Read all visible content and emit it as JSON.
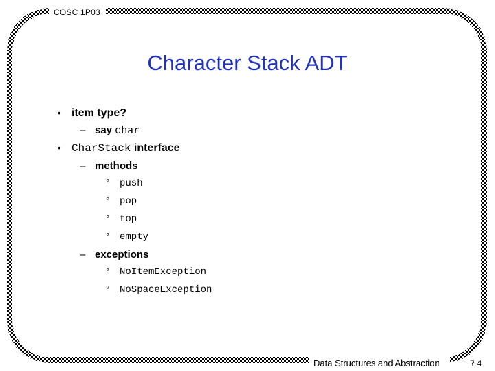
{
  "slide": {
    "header_label": "COSC 1P03",
    "title": "Character Stack ADT",
    "footer_label": "Data Structures and Abstraction",
    "slide_number": "7.4",
    "title_color": "#2233bb",
    "background_color": "#ffffff",
    "frame_color": "#000000"
  },
  "markers": {
    "level1": "•",
    "level2": "–",
    "level3": "°"
  },
  "body": {
    "items": [
      {
        "level": 1,
        "runs": [
          {
            "text": "item type?",
            "font": "sans-bold"
          }
        ]
      },
      {
        "level": 2,
        "runs": [
          {
            "text": "say ",
            "font": "sans-bold"
          },
          {
            "text": "char",
            "font": "mono"
          }
        ]
      },
      {
        "level": 1,
        "runs": [
          {
            "text": "CharStack",
            "font": "mono"
          },
          {
            "text": " interface",
            "font": "sans-bold"
          }
        ]
      },
      {
        "level": 2,
        "runs": [
          {
            "text": "methods",
            "font": "sans-bold"
          }
        ]
      },
      {
        "level": 3,
        "runs": [
          {
            "text": "push",
            "font": "mono"
          }
        ]
      },
      {
        "level": 3,
        "runs": [
          {
            "text": "pop",
            "font": "mono"
          }
        ]
      },
      {
        "level": 3,
        "runs": [
          {
            "text": "top",
            "font": "mono"
          }
        ]
      },
      {
        "level": 3,
        "runs": [
          {
            "text": "empty",
            "font": "mono"
          }
        ]
      },
      {
        "level": 2,
        "runs": [
          {
            "text": "exceptions",
            "font": "sans-bold"
          }
        ]
      },
      {
        "level": 3,
        "runs": [
          {
            "text": "NoItemException",
            "font": "mono"
          }
        ]
      },
      {
        "level": 3,
        "runs": [
          {
            "text": "NoSpaceException",
            "font": "mono"
          }
        ]
      }
    ]
  }
}
